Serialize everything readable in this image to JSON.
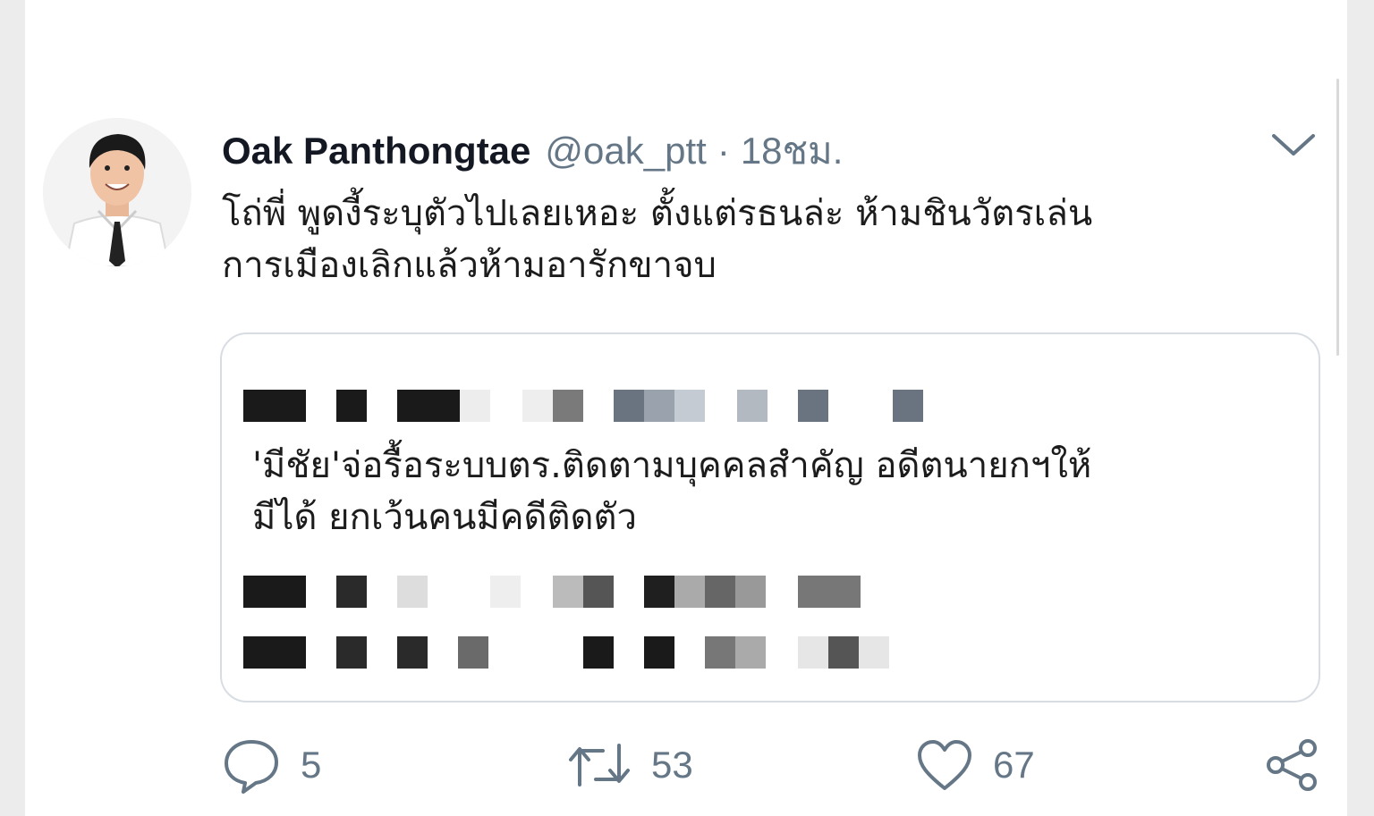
{
  "tweet": {
    "display_name": "Oak Panthongtae",
    "handle": "@oak_ptt",
    "separator": "·",
    "time": "18ชม.",
    "text_line1": "โถ่พี่ พูดงี้ระบุตัวไปเลยเหอะ ตั้งแต่รธนล่ะ ห้ามชินวัตรเล่น",
    "text_line2": "การเมืองเลิกแล้วห้ามอารักขาจบ"
  },
  "quote": {
    "text_line1": "'มีชัย'จ่อรื้อระบบตร.ติดตามบุคคลสำคัญ อดีตนายกฯให้",
    "text_line2": "มีได้ ยกเว้นคนมีคดีติดตัว",
    "redacted_note": "pixelated text"
  },
  "actions": {
    "replies": "5",
    "retweets": "53",
    "likes": "67"
  },
  "icons": {
    "menu": "chevron-down-icon",
    "reply": "speech-bubble-icon",
    "retweet": "retweet-arrows-icon",
    "like": "heart-icon",
    "share": "share-nodes-icon"
  },
  "colors": {
    "text": "#1c1c1c",
    "secondary": "#657786",
    "border": "#d8dde3"
  }
}
